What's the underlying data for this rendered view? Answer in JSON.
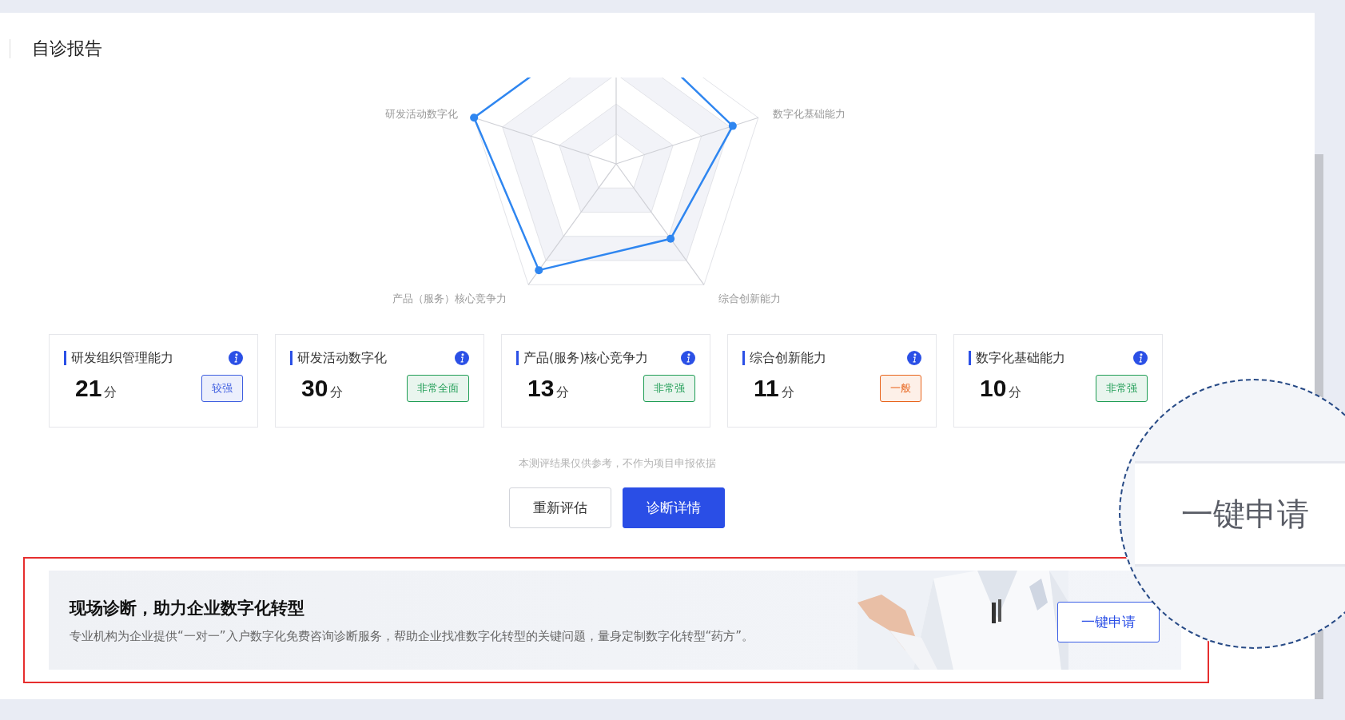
{
  "header": {
    "title": "自诊报告"
  },
  "radar": {
    "axis_labels": [
      "研发活动数字化",
      "数字化基础能力",
      "综合创新能力",
      "产品（服务）核心竞争力"
    ]
  },
  "cards": [
    {
      "title": "研发组织管理能力",
      "score": "21",
      "unit": "分",
      "rating": "较强",
      "color": "#3f5fe0"
    },
    {
      "title": "研发活动数字化",
      "score": "30",
      "unit": "分",
      "rating": "非常全面",
      "color": "#1f9d55"
    },
    {
      "title": "产品(服务)核心竞争力",
      "score": "13",
      "unit": "分",
      "rating": "非常强",
      "color": "#1f9d55"
    },
    {
      "title": "综合创新能力",
      "score": "11",
      "unit": "分",
      "rating": "一般",
      "color": "#e8641b"
    },
    {
      "title": "数字化基础能力",
      "score": "10",
      "unit": "分",
      "rating": "非常强",
      "color": "#1f9d55"
    }
  ],
  "disclaimer": "本测评结果仅供参考，不作为项目申报依据",
  "buttons": [
    {
      "label": "重新评估",
      "primary": false
    },
    {
      "label": "诊断详情",
      "primary": true
    }
  ],
  "banner": {
    "title": "现场诊断，助力企业数字化转型",
    "description": "专业机构为企业提供“一对一”入户数字化免费咨询诊断服务，帮助企业找准数字化转型的关键问题，量身定制数字化转型“药方”。",
    "button": "一键申请"
  },
  "magnifier": {
    "text": "一键申请"
  }
}
